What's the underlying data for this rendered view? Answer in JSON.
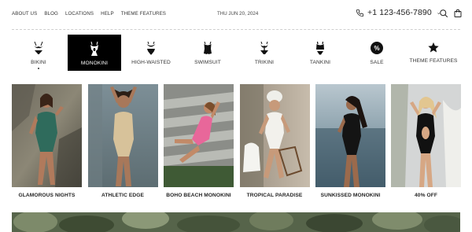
{
  "topbar": {
    "links": [
      "ABOUT US",
      "BLOG",
      "LOCATIONS",
      "HELP",
      "THEME FEATURES"
    ],
    "date": "THU JUN 20, 2024",
    "phone": "+1 123-456-7890"
  },
  "categories": [
    {
      "label": "BIKINI",
      "icon": "bikini-icon",
      "active": false
    },
    {
      "label": "MONOKINI",
      "icon": "monokini-icon",
      "active": true
    },
    {
      "label": "HIGH-WAISTED",
      "icon": "high-waisted-icon",
      "active": false
    },
    {
      "label": "SWIMSUIT",
      "icon": "swimsuit-icon",
      "active": false
    },
    {
      "label": "TRIKINI",
      "icon": "trikini-icon",
      "active": false
    },
    {
      "label": "TANKINI",
      "icon": "tankini-icon",
      "active": false
    },
    {
      "label": "SALE",
      "icon": "percent-icon",
      "badge": "%",
      "active": false
    },
    {
      "label": "THEME FEATURES",
      "icon": "star-icon",
      "active": false
    }
  ],
  "products": [
    {
      "title": "GLAMOROUS NIGHTS",
      "image": "model-green-swimsuit-image"
    },
    {
      "title": "ATHLETIC EDGE",
      "image": "model-gold-swimsuit-image"
    },
    {
      "title": "BOHO BEACH MONOKINI",
      "image": "model-pink-swimsuit-image"
    },
    {
      "title": "TROPICAL PARADISE",
      "image": "model-white-swimsuit-image"
    },
    {
      "title": "SUNKISSED MONOKINI",
      "image": "model-black-swimsuit-sea-image"
    },
    {
      "title": "40% OFF",
      "image": "model-black-monokini-image"
    }
  ],
  "colors": {
    "accent": "#000000",
    "text": "#222222",
    "divider": "#cfcfcf"
  }
}
